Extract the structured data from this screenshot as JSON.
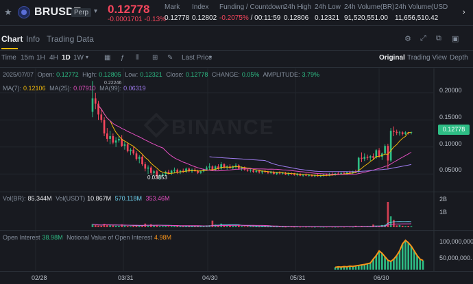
{
  "header": {
    "symbol": "BRUSDT",
    "contract_type": "Perp",
    "last_price": "0.12778",
    "price_change": "-0.0001701 -0.13%",
    "stats": [
      {
        "label": "Mark",
        "value": "0.12778"
      },
      {
        "label": "Index",
        "value": "0.12802"
      },
      {
        "label": "Funding / Countdown",
        "value": "-0.2075%",
        "value2": "/ 00:11:59"
      },
      {
        "label": "24h High",
        "value": "0.12806"
      },
      {
        "label": "24h Low",
        "value": "0.12321"
      },
      {
        "label": "24h Volume(BR)",
        "value": "91,520,551.00"
      },
      {
        "label": "24h Volume(USD",
        "value": "11,656,510.42"
      }
    ],
    "colors": {
      "up": "#2ebd85",
      "down": "#f6465d",
      "accent": "#f0b90b"
    }
  },
  "tabs": [
    {
      "label": "Chart",
      "active": true
    },
    {
      "label": "Info",
      "active": false
    },
    {
      "label": "Trading Data",
      "active": false
    }
  ],
  "toolbar": {
    "intervals": [
      "Time",
      "15m",
      "1H",
      "4H",
      "1D",
      "1W"
    ],
    "active_interval": "1D",
    "price_type": "Last Price",
    "views": [
      "Original",
      "Trading View",
      "Depth"
    ],
    "active_view": "Original"
  },
  "main_pane": {
    "ohlc": {
      "date": "2025/07/07",
      "open_label": "Open:",
      "open": "0.12772",
      "high_label": "High:",
      "high": "0.12805",
      "low_label": "Low:",
      "low": "0.12321",
      "close_label": "Close:",
      "close": "0.12778",
      "change_label": "CHANGE:",
      "change": "0.05%",
      "amp_label": "AMPLITUDE:",
      "amp": "3.79%"
    },
    "ma": {
      "ma7_label": "MA(7):",
      "ma7": "0.12106",
      "ma25_label": "MA(25):",
      "ma25": "0.07910",
      "ma99_label": "MA(99):",
      "ma99": "0.06319"
    },
    "y_ticks": [
      "0.20000",
      "0.15000",
      "0.10000",
      "0.05000"
    ],
    "current_price_tag": "0.12778",
    "high_marker": "0.22246",
    "low_marker": "0.03853",
    "watermark": "BINANCE"
  },
  "volume_pane": {
    "label1": "Vol(BR):",
    "vol_br": "85.344M",
    "label2": "Vol(USDT)",
    "vol_usdt": "10.867M",
    "vol_usdt_ma": "570.118M",
    "vol_usdt_ma2": "353.46M",
    "y_ticks": [
      "2B",
      "1B"
    ]
  },
  "oi_pane": {
    "label": "Open Interest",
    "value": "38.98M",
    "notional_label": "Notional Value of Open Interest",
    "notional": "4.98M",
    "y_ticks": [
      "100,000,000.",
      "50,000,000."
    ]
  },
  "x_axis": [
    "02/28",
    "03/31",
    "04/30",
    "05/31",
    "06/30"
  ],
  "chart_data": {
    "type": "candlestick",
    "x": [
      "03/20",
      "03/21",
      "03/22",
      "03/23",
      "03/24",
      "03/25",
      "03/26",
      "03/27",
      "03/28",
      "03/29",
      "03/30",
      "03/31",
      "04/01",
      "04/02",
      "04/03",
      "04/04",
      "04/05",
      "04/06",
      "04/07",
      "04/08",
      "04/09",
      "04/10",
      "04/11",
      "04/12",
      "04/13",
      "04/14",
      "04/15",
      "04/16",
      "04/17",
      "04/18",
      "04/19",
      "04/20",
      "04/21",
      "04/22",
      "04/23",
      "04/24",
      "04/25",
      "04/26",
      "04/27",
      "04/28",
      "04/29",
      "04/30",
      "05/01",
      "05/02",
      "05/03",
      "05/04",
      "05/05",
      "05/06",
      "05/07",
      "05/08",
      "05/09",
      "05/10",
      "05/11",
      "05/12",
      "05/13",
      "05/14",
      "05/15",
      "05/16",
      "05/17",
      "05/18",
      "05/19",
      "05/20",
      "05/21",
      "05/22",
      "05/23",
      "05/24",
      "05/25",
      "05/26",
      "05/27",
      "05/28",
      "05/29",
      "05/30",
      "05/31",
      "06/01",
      "06/02",
      "06/03",
      "06/04",
      "06/05",
      "06/06",
      "06/07",
      "06/08",
      "06/09",
      "06/10",
      "06/11",
      "06/12",
      "06/13",
      "06/14",
      "06/15",
      "06/16",
      "06/17",
      "06/18",
      "06/19",
      "06/20",
      "06/21",
      "06/22",
      "06/23",
      "06/24",
      "06/25",
      "06/26",
      "06/27",
      "06/28",
      "06/29",
      "06/30",
      "07/01",
      "07/02",
      "07/03",
      "07/04",
      "07/05",
      "07/06",
      "07/07"
    ],
    "ohlc": [
      [
        0.165,
        0.222,
        0.155,
        0.19
      ],
      [
        0.19,
        0.2,
        0.17,
        0.18
      ],
      [
        0.18,
        0.185,
        0.15,
        0.16
      ],
      [
        0.16,
        0.17,
        0.145,
        0.15
      ],
      [
        0.15,
        0.155,
        0.12,
        0.125
      ],
      [
        0.125,
        0.135,
        0.11,
        0.115
      ],
      [
        0.115,
        0.13,
        0.105,
        0.12
      ],
      [
        0.12,
        0.125,
        0.105,
        0.108
      ],
      [
        0.108,
        0.118,
        0.1,
        0.112
      ],
      [
        0.112,
        0.12,
        0.108,
        0.115
      ],
      [
        0.115,
        0.122,
        0.1,
        0.102
      ],
      [
        0.102,
        0.11,
        0.095,
        0.105
      ],
      [
        0.105,
        0.108,
        0.09,
        0.092
      ],
      [
        0.092,
        0.098,
        0.085,
        0.095
      ],
      [
        0.095,
        0.1,
        0.085,
        0.088
      ],
      [
        0.088,
        0.092,
        0.075,
        0.078
      ],
      [
        0.078,
        0.085,
        0.07,
        0.082
      ],
      [
        0.082,
        0.085,
        0.065,
        0.068
      ],
      [
        0.068,
        0.072,
        0.055,
        0.06
      ],
      [
        0.06,
        0.066,
        0.05,
        0.062
      ],
      [
        0.062,
        0.065,
        0.048,
        0.052
      ],
      [
        0.052,
        0.058,
        0.045,
        0.055
      ],
      [
        0.055,
        0.058,
        0.042,
        0.046
      ],
      [
        0.046,
        0.05,
        0.039,
        0.048
      ],
      [
        0.048,
        0.052,
        0.044,
        0.05
      ],
      [
        0.05,
        0.056,
        0.046,
        0.054
      ],
      [
        0.054,
        0.058,
        0.049,
        0.051
      ],
      [
        0.051,
        0.058,
        0.048,
        0.056
      ],
      [
        0.056,
        0.062,
        0.052,
        0.058
      ],
      [
        0.058,
        0.06,
        0.05,
        0.053
      ],
      [
        0.053,
        0.058,
        0.05,
        0.056
      ],
      [
        0.056,
        0.06,
        0.052,
        0.054
      ],
      [
        0.054,
        0.062,
        0.052,
        0.06
      ],
      [
        0.06,
        0.062,
        0.053,
        0.055
      ],
      [
        0.055,
        0.06,
        0.052,
        0.058
      ],
      [
        0.058,
        0.062,
        0.054,
        0.056
      ],
      [
        0.056,
        0.058,
        0.05,
        0.052
      ],
      [
        0.052,
        0.057,
        0.05,
        0.055
      ],
      [
        0.055,
        0.06,
        0.053,
        0.058
      ],
      [
        0.058,
        0.065,
        0.056,
        0.062
      ],
      [
        0.062,
        0.07,
        0.058,
        0.064
      ],
      [
        0.064,
        0.066,
        0.056,
        0.058
      ],
      [
        0.058,
        0.066,
        0.056,
        0.064
      ],
      [
        0.064,
        0.068,
        0.058,
        0.06
      ],
      [
        0.06,
        0.072,
        0.058,
        0.068
      ],
      [
        0.068,
        0.07,
        0.06,
        0.062
      ],
      [
        0.062,
        0.066,
        0.058,
        0.064
      ],
      [
        0.064,
        0.068,
        0.06,
        0.061
      ],
      [
        0.061,
        0.066,
        0.058,
        0.064
      ],
      [
        0.064,
        0.07,
        0.06,
        0.066
      ],
      [
        0.066,
        0.068,
        0.058,
        0.06
      ],
      [
        0.06,
        0.064,
        0.056,
        0.062
      ],
      [
        0.062,
        0.064,
        0.056,
        0.058
      ],
      [
        0.058,
        0.06,
        0.054,
        0.056
      ],
      [
        0.056,
        0.06,
        0.053,
        0.057
      ],
      [
        0.057,
        0.06,
        0.052,
        0.054
      ],
      [
        0.054,
        0.058,
        0.052,
        0.056
      ],
      [
        0.056,
        0.058,
        0.051,
        0.053
      ],
      [
        0.053,
        0.057,
        0.05,
        0.055
      ],
      [
        0.055,
        0.058,
        0.052,
        0.054
      ],
      [
        0.054,
        0.056,
        0.05,
        0.052
      ],
      [
        0.052,
        0.056,
        0.05,
        0.054
      ],
      [
        0.054,
        0.056,
        0.049,
        0.05
      ],
      [
        0.05,
        0.054,
        0.048,
        0.053
      ],
      [
        0.053,
        0.055,
        0.049,
        0.051
      ],
      [
        0.051,
        0.054,
        0.049,
        0.052
      ],
      [
        0.052,
        0.054,
        0.048,
        0.049
      ],
      [
        0.049,
        0.053,
        0.047,
        0.051
      ],
      [
        0.051,
        0.053,
        0.048,
        0.05
      ],
      [
        0.05,
        0.052,
        0.047,
        0.048
      ],
      [
        0.048,
        0.052,
        0.046,
        0.05
      ],
      [
        0.05,
        0.052,
        0.046,
        0.047
      ],
      [
        0.047,
        0.05,
        0.045,
        0.049
      ],
      [
        0.049,
        0.051,
        0.046,
        0.047
      ],
      [
        0.047,
        0.05,
        0.045,
        0.048
      ],
      [
        0.048,
        0.05,
        0.045,
        0.046
      ],
      [
        0.046,
        0.049,
        0.044,
        0.048
      ],
      [
        0.048,
        0.05,
        0.045,
        0.046
      ],
      [
        0.046,
        0.049,
        0.044,
        0.047
      ],
      [
        0.047,
        0.05,
        0.045,
        0.049
      ],
      [
        0.049,
        0.051,
        0.046,
        0.048
      ],
      [
        0.048,
        0.052,
        0.046,
        0.05
      ],
      [
        0.05,
        0.053,
        0.047,
        0.049
      ],
      [
        0.049,
        0.052,
        0.047,
        0.051
      ],
      [
        0.051,
        0.054,
        0.048,
        0.05
      ],
      [
        0.05,
        0.053,
        0.048,
        0.052
      ],
      [
        0.052,
        0.055,
        0.049,
        0.051
      ],
      [
        0.051,
        0.054,
        0.048,
        0.053
      ],
      [
        0.053,
        0.056,
        0.05,
        0.052
      ],
      [
        0.052,
        0.056,
        0.05,
        0.055
      ],
      [
        0.055,
        0.058,
        0.052,
        0.054
      ],
      [
        0.054,
        0.082,
        0.052,
        0.08
      ],
      [
        0.08,
        0.09,
        0.072,
        0.078
      ],
      [
        0.078,
        0.088,
        0.074,
        0.082
      ],
      [
        0.082,
        0.086,
        0.076,
        0.08
      ],
      [
        0.08,
        0.085,
        0.074,
        0.083
      ],
      [
        0.083,
        0.088,
        0.076,
        0.08
      ],
      [
        0.08,
        0.096,
        0.078,
        0.094
      ],
      [
        0.094,
        0.098,
        0.08,
        0.082
      ],
      [
        0.082,
        0.09,
        0.076,
        0.088
      ],
      [
        0.088,
        0.105,
        0.085,
        0.102
      ],
      [
        0.102,
        0.106,
        0.06,
        0.075
      ],
      [
        0.075,
        0.135,
        0.072,
        0.13
      ],
      [
        0.13,
        0.138,
        0.12,
        0.128
      ],
      [
        0.128,
        0.132,
        0.122,
        0.126
      ],
      [
        0.126,
        0.13,
        0.121,
        0.127
      ],
      [
        0.127,
        0.129,
        0.121,
        0.124
      ],
      [
        0.124,
        0.129,
        0.122,
        0.127
      ],
      [
        0.127,
        0.128,
        0.123,
        0.126
      ],
      [
        0.12772,
        0.12805,
        0.12321,
        0.12778
      ]
    ],
    "ylim": [
      0.02,
      0.23
    ],
    "y_ticks": [
      0.2,
      0.15,
      0.1,
      0.05
    ],
    "series_ma": [
      {
        "name": "MA(7)",
        "color": "#f0b90b"
      },
      {
        "name": "MA(25)",
        "color": "#e44fc1"
      },
      {
        "name": "MA(99)",
        "color": "#a07cf0"
      }
    ],
    "volume": {
      "ylim": [
        0,
        2500
      ],
      "unit": "M",
      "ticks": [
        2000,
        1000
      ],
      "values": [
        260,
        180,
        150,
        120,
        280,
        220,
        160,
        140,
        120,
        110,
        240,
        130,
        100,
        90,
        180,
        120,
        110,
        160,
        300,
        120,
        250,
        130,
        200,
        100,
        90,
        110,
        80,
        100,
        90,
        120,
        80,
        70,
        110,
        80,
        90,
        70,
        120,
        80,
        90,
        150,
        170,
        540,
        220,
        150,
        300,
        140,
        100,
        160,
        110,
        130,
        160,
        100,
        80,
        90,
        70,
        60,
        80,
        50,
        70,
        60,
        50,
        60,
        70,
        50,
        60,
        50,
        40,
        60,
        50,
        40,
        50,
        40,
        50,
        40,
        50,
        40,
        30,
        50,
        40,
        30,
        40,
        50,
        40,
        30,
        40,
        50,
        40,
        60,
        50,
        40,
        120,
        60,
        110,
        70,
        80,
        90,
        220,
        100,
        90,
        180,
        200,
        2100,
        900,
        600,
        150,
        180,
        120,
        100,
        110,
        85
      ]
    },
    "open_interest": {
      "ylim": [
        0,
        140
      ],
      "unit": "M",
      "ticks": [
        100,
        50
      ],
      "values": [
        0,
        0,
        0,
        0,
        0,
        0,
        0,
        0,
        0,
        0,
        0,
        0,
        0,
        0,
        0,
        0,
        0,
        0,
        0,
        0,
        0,
        0,
        0,
        0,
        0,
        0,
        0,
        0,
        0,
        0,
        0,
        0,
        0,
        0,
        0,
        0,
        0,
        0,
        0,
        0,
        0,
        0,
        0,
        0,
        0,
        0,
        0,
        0,
        0,
        0,
        0,
        0,
        0,
        0,
        0,
        0,
        0,
        0,
        0,
        0,
        0,
        0,
        0,
        0,
        0,
        0,
        0,
        0,
        0,
        0,
        0,
        0,
        0,
        0,
        0,
        0,
        0,
        0,
        0,
        0,
        0,
        0,
        0,
        10,
        12,
        11,
        13,
        12,
        15,
        14,
        16,
        18,
        20,
        22,
        25,
        28,
        45,
        60,
        80,
        70,
        55,
        40,
        35,
        45,
        60,
        80,
        110,
        125,
        115,
        100,
        80,
        60,
        45,
        39
      ]
    }
  }
}
